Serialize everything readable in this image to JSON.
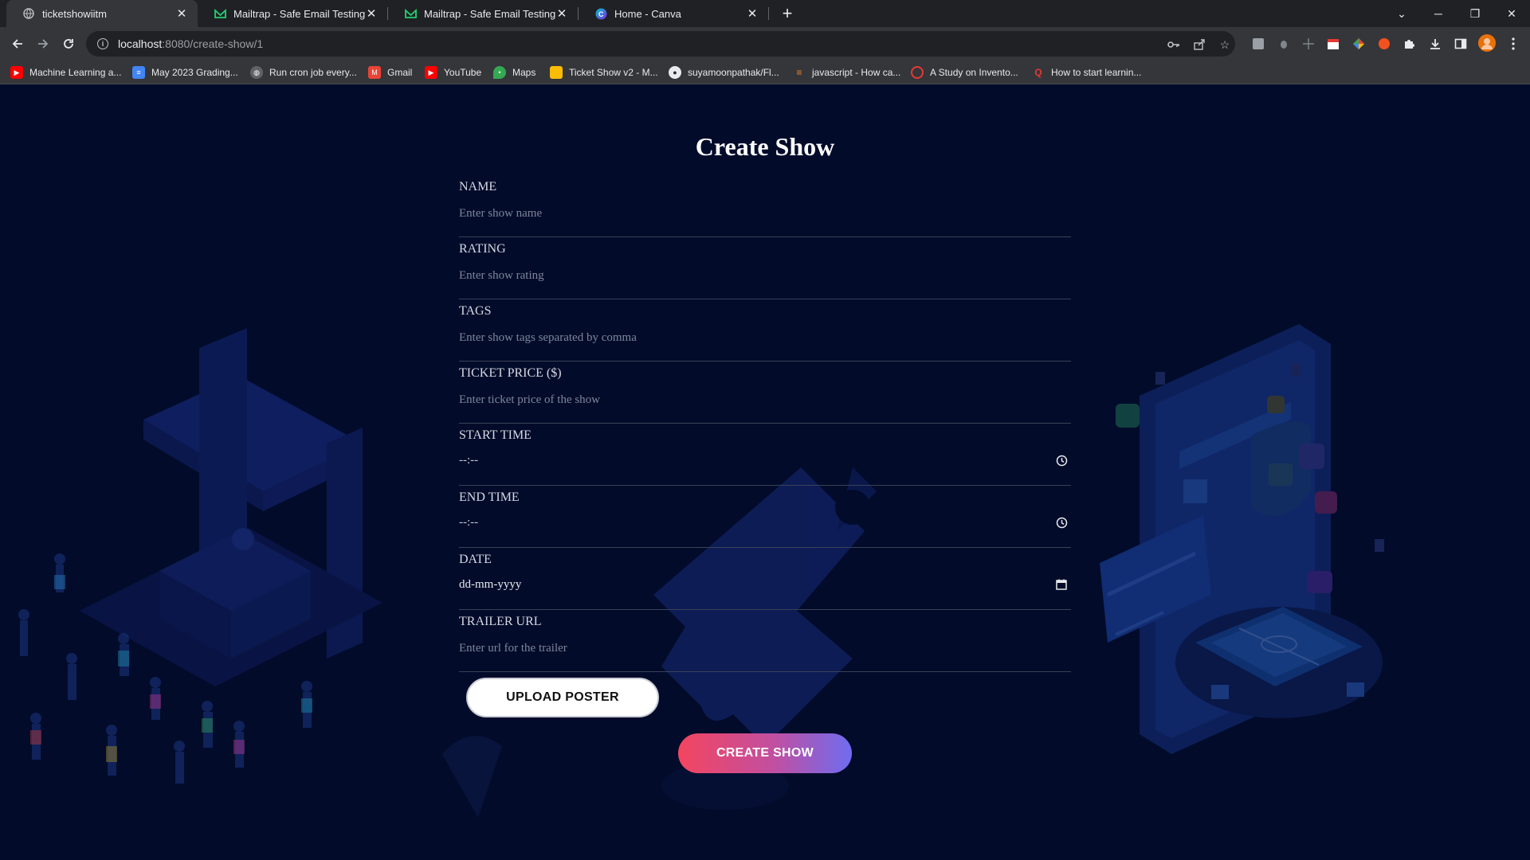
{
  "browser": {
    "tabs": [
      {
        "title": "ticketshowiitm",
        "active": true,
        "icon": "globe-icon"
      },
      {
        "title": "Mailtrap - Safe Email Testing",
        "active": false,
        "icon": "mailtrap-icon"
      },
      {
        "title": "Mailtrap - Safe Email Testing",
        "active": false,
        "icon": "mailtrap-icon"
      },
      {
        "title": "Home - Canva",
        "active": false,
        "icon": "canva-icon"
      }
    ],
    "url_host": "localhost",
    "url_rest": ":8080/create-show/1",
    "bookmarks": [
      {
        "label": "Machine Learning a...",
        "icon": "youtube-icon",
        "color": "#ff0000"
      },
      {
        "label": "May 2023 Grading...",
        "icon": "docs-icon",
        "color": "#4285f4"
      },
      {
        "label": "Run cron job every...",
        "icon": "globe-icon",
        "color": "#5f6368"
      },
      {
        "label": "Gmail",
        "icon": "gmail-icon",
        "color": "#ea4335"
      },
      {
        "label": "YouTube",
        "icon": "youtube-icon",
        "color": "#ff0000"
      },
      {
        "label": "Maps",
        "icon": "maps-icon",
        "color": "#34a853"
      },
      {
        "label": "Ticket Show v2 - M...",
        "icon": "slides-icon",
        "color": "#fbbc04"
      },
      {
        "label": "suyamoonpathak/Fl...",
        "icon": "github-icon",
        "color": "#24292e"
      },
      {
        "label": "javascript - How ca...",
        "icon": "stackoverflow-icon",
        "color": "#f48024"
      },
      {
        "label": "A Study on Invento...",
        "icon": "target-icon",
        "color": "#e53935"
      },
      {
        "label": "How to start learnin...",
        "icon": "quora-icon",
        "color": "#b92b27"
      }
    ]
  },
  "form": {
    "title": "Create Show",
    "fields": [
      {
        "label": "NAME",
        "placeholder": "Enter show name"
      },
      {
        "label": "RATING",
        "placeholder": "Enter show rating"
      },
      {
        "label": "TAGS",
        "placeholder": "Enter show tags separated by comma"
      },
      {
        "label": "TICKET PRICE ($)",
        "placeholder": "Enter ticket price of the show"
      },
      {
        "label": "START TIME",
        "value": "--:--",
        "icon": "clock-icon"
      },
      {
        "label": "END TIME",
        "value": "--:--",
        "icon": "clock-icon"
      },
      {
        "label": "DATE",
        "value": "dd-mm-yyyy",
        "icon": "calendar-icon"
      },
      {
        "label": "TRAILER URL",
        "placeholder": "Enter url for the trailer"
      }
    ],
    "upload_label": "UPLOAD POSTER",
    "submit_label": "CREATE SHOW"
  },
  "colors": {
    "page_bg": "#020b2a",
    "accent_start": "#f4455f",
    "accent_end": "#6e6cf0"
  }
}
